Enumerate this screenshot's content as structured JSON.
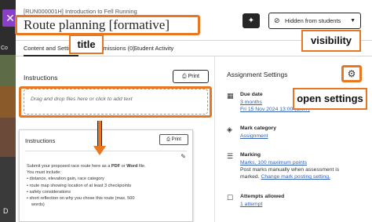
{
  "header": {
    "breadcrumb": "[RUN000001H] Introduction to Fell Running",
    "title": "Route planning [formative]",
    "visibility_label": "Hidden from students",
    "close_icon": "close-icon",
    "sparkle_icon": "sparkle-icon"
  },
  "left_strip": {
    "text_top": "Co",
    "text_bottom": "D"
  },
  "tabs": [
    {
      "label": "Content and Settings"
    },
    {
      "label": "Submissions (0)"
    },
    {
      "label": "Student Activity"
    }
  ],
  "instructions": {
    "heading": "Instructions",
    "print_label": "Print",
    "dropzone_text": "Drag and drop files here or click to add text"
  },
  "preview": {
    "heading": "Instructions",
    "print_label": "Print",
    "intro_before": "Submit your proposed race route here as a ",
    "intro_bold_1": "PDF",
    "intro_mid": " or ",
    "intro_bold_2": "Word",
    "intro_after": " file.",
    "must_include": "You must include:",
    "items": [
      "• distance, elevation gain, race category",
      "• route map showing location of at least 3 checkpoints",
      "• safety considerations",
      "• short reflection on why you chose this route (max. 500"
    ],
    "last_line": "words)"
  },
  "settings": {
    "title": "Assignment Settings",
    "due_label": "Due date",
    "due_value": "3 months",
    "due_date": "Fri 15 Nov 2024 13:00 (GMT)",
    "category_label": "Mark category",
    "category_value": "Assignment",
    "marking_label": "Marking",
    "marking_value": "Marks, 100 maximum points",
    "marking_note_1": "Post marks manually when assessment is",
    "marking_note_2_prefix": "marked. ",
    "marking_note_2_link": "Change mark posting setting.",
    "attempts_label": "Attempts allowed",
    "attempts_value": "1 attempt"
  },
  "annotations": {
    "title": "title",
    "visibility": "visibility",
    "open_settings": "open settings",
    "accent": "#e87722"
  }
}
